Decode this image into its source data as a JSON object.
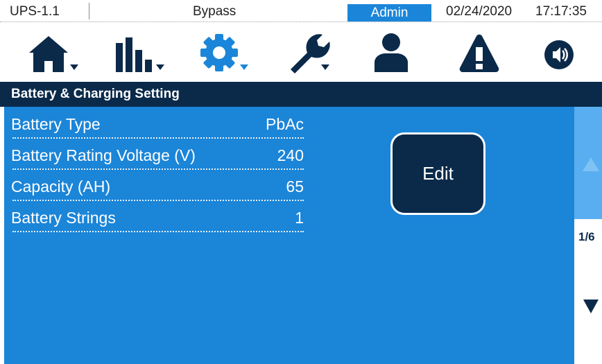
{
  "status_bar": {
    "device": "UPS-1.1",
    "mode": "Bypass",
    "user": "Admin",
    "date": "02/24/2020",
    "time": "17:17:35"
  },
  "toolbar": {
    "icons": [
      "home-icon",
      "bar-chart-icon",
      "gear-icon",
      "wrench-icon",
      "user-icon",
      "warning-icon",
      "sound-icon"
    ],
    "active": "gear-icon",
    "colors": {
      "icon": "#0b2a4a",
      "active": "#1b86d9"
    }
  },
  "title": "Battery & Charging Setting",
  "settings": [
    {
      "label": "Battery Type",
      "value": "PbAc"
    },
    {
      "label": "Battery Rating Voltage (V)",
      "value": "240"
    },
    {
      "label": "Capacity (AH)",
      "value": "65"
    },
    {
      "label": "Battery Strings",
      "value": "1"
    }
  ],
  "edit_label": "Edit",
  "pagination": {
    "indicator": "1/6"
  },
  "colors": {
    "panel": "#1b85d8",
    "header": "#0b2a4a",
    "scroll_up": "#58aef0"
  }
}
